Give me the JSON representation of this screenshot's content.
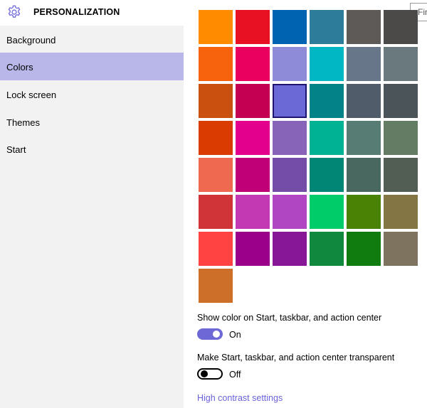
{
  "header": {
    "title": "PERSONALIZATION",
    "icon": "gear-icon",
    "search_placeholder": "Find a setting"
  },
  "sidebar": {
    "items": [
      {
        "label": "Background",
        "selected": false
      },
      {
        "label": "Colors",
        "selected": true
      },
      {
        "label": "Lock screen",
        "selected": false
      },
      {
        "label": "Themes",
        "selected": false
      },
      {
        "label": "Start",
        "selected": false
      }
    ]
  },
  "accent_palette": {
    "selected": "#6b69d6",
    "rows": [
      [
        "#ff8c00",
        "#e81123",
        "#0063b1",
        "#2d7d9a",
        "#5d5a58",
        "#4c4a48"
      ],
      [
        "#f7630c",
        "#ea005e",
        "#8e8cd8",
        "#00b7c3",
        "#68768a",
        "#69797e"
      ],
      [
        "#ca5010",
        "#c30052",
        "#6b69d6",
        "#038387",
        "#515c6b",
        "#4a5459"
      ],
      [
        "#da3b01",
        "#e3008c",
        "#8764b8",
        "#00b294",
        "#567c73",
        "#647c64"
      ],
      [
        "#ef6950",
        "#bf0077",
        "#744da9",
        "#018574",
        "#486860",
        "#525e54"
      ],
      [
        "#d13438",
        "#c239b3",
        "#b146c2",
        "#00cc6a",
        "#498205",
        "#847545"
      ],
      [
        "#ff4343",
        "#9a0089",
        "#881798",
        "#10893e",
        "#107c10",
        "#7e735f"
      ],
      [
        "#cd6f28"
      ]
    ]
  },
  "options": {
    "show_color": {
      "label": "Show color on Start, taskbar, and action center",
      "state": "On",
      "on": true
    },
    "transparent": {
      "label": "Make Start, taskbar, and action center transparent",
      "state": "Off",
      "on": false
    }
  },
  "link": {
    "label": "High contrast settings"
  },
  "colors": {
    "accent": "#6b69d6",
    "sidebar_bg": "#f2f2f2",
    "selected_nav": "#b9b7ea"
  }
}
